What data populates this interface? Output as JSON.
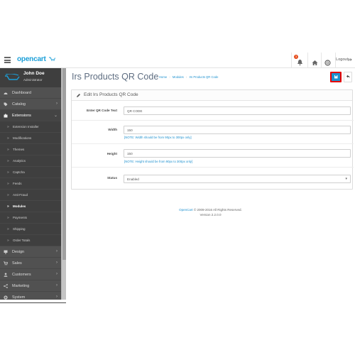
{
  "header": {
    "logo_text": "opencart",
    "alert_count": "3",
    "logout_label": "Logout"
  },
  "profile": {
    "name": "John Doe",
    "role": "Administrator"
  },
  "sidebar": {
    "top_items": [
      {
        "label": "Dashboard",
        "icon": "dashboard-icon"
      },
      {
        "label": "Catalog",
        "icon": "tag-icon"
      },
      {
        "label": "Extensions",
        "icon": "puzzle-icon"
      }
    ],
    "extension_submenu": [
      {
        "label": "Extension Installer"
      },
      {
        "label": "Modifications"
      },
      {
        "label": "Themes"
      },
      {
        "label": "Analytics"
      },
      {
        "label": "Captcha"
      },
      {
        "label": "Feeds"
      },
      {
        "label": "Anti-Fraud"
      },
      {
        "label": "Modules"
      },
      {
        "label": "Payments"
      },
      {
        "label": "Shipping"
      },
      {
        "label": "Order Totals"
      }
    ],
    "bottom_items": [
      {
        "label": "Design",
        "icon": "desktop-icon"
      },
      {
        "label": "Sales",
        "icon": "cart-icon"
      },
      {
        "label": "Customers",
        "icon": "user-icon"
      },
      {
        "label": "Marketing",
        "icon": "share-icon"
      },
      {
        "label": "System",
        "icon": "cog-icon"
      }
    ]
  },
  "page": {
    "title": "Irs Products QR Code",
    "breadcrumb": [
      "Home",
      "Modules",
      "Irs Products QR Code"
    ]
  },
  "panel": {
    "title": "Edit Irs Products QR Code"
  },
  "form": {
    "qr_label": "Enter QR Code Text",
    "qr_value": "QR CODE",
    "width_label": "Width",
    "width_value": "150",
    "width_help": "[NOTE: Width should be from 90px to 300px only]",
    "height_label": "Height",
    "height_value": "150",
    "height_help": "[NOTE: Height should be from 90px to 300px only]",
    "status_label": "Status",
    "status_value": "Enabled"
  },
  "footer": {
    "brand_link": "OpenCart",
    "copyright": "© 2009-2016 All Rights Reserved.",
    "version": "Version 2.2.0.0"
  },
  "colors": {
    "accent": "#1e91cf",
    "sidebar_bg": "#515151",
    "highlight_border": "#e50000"
  }
}
